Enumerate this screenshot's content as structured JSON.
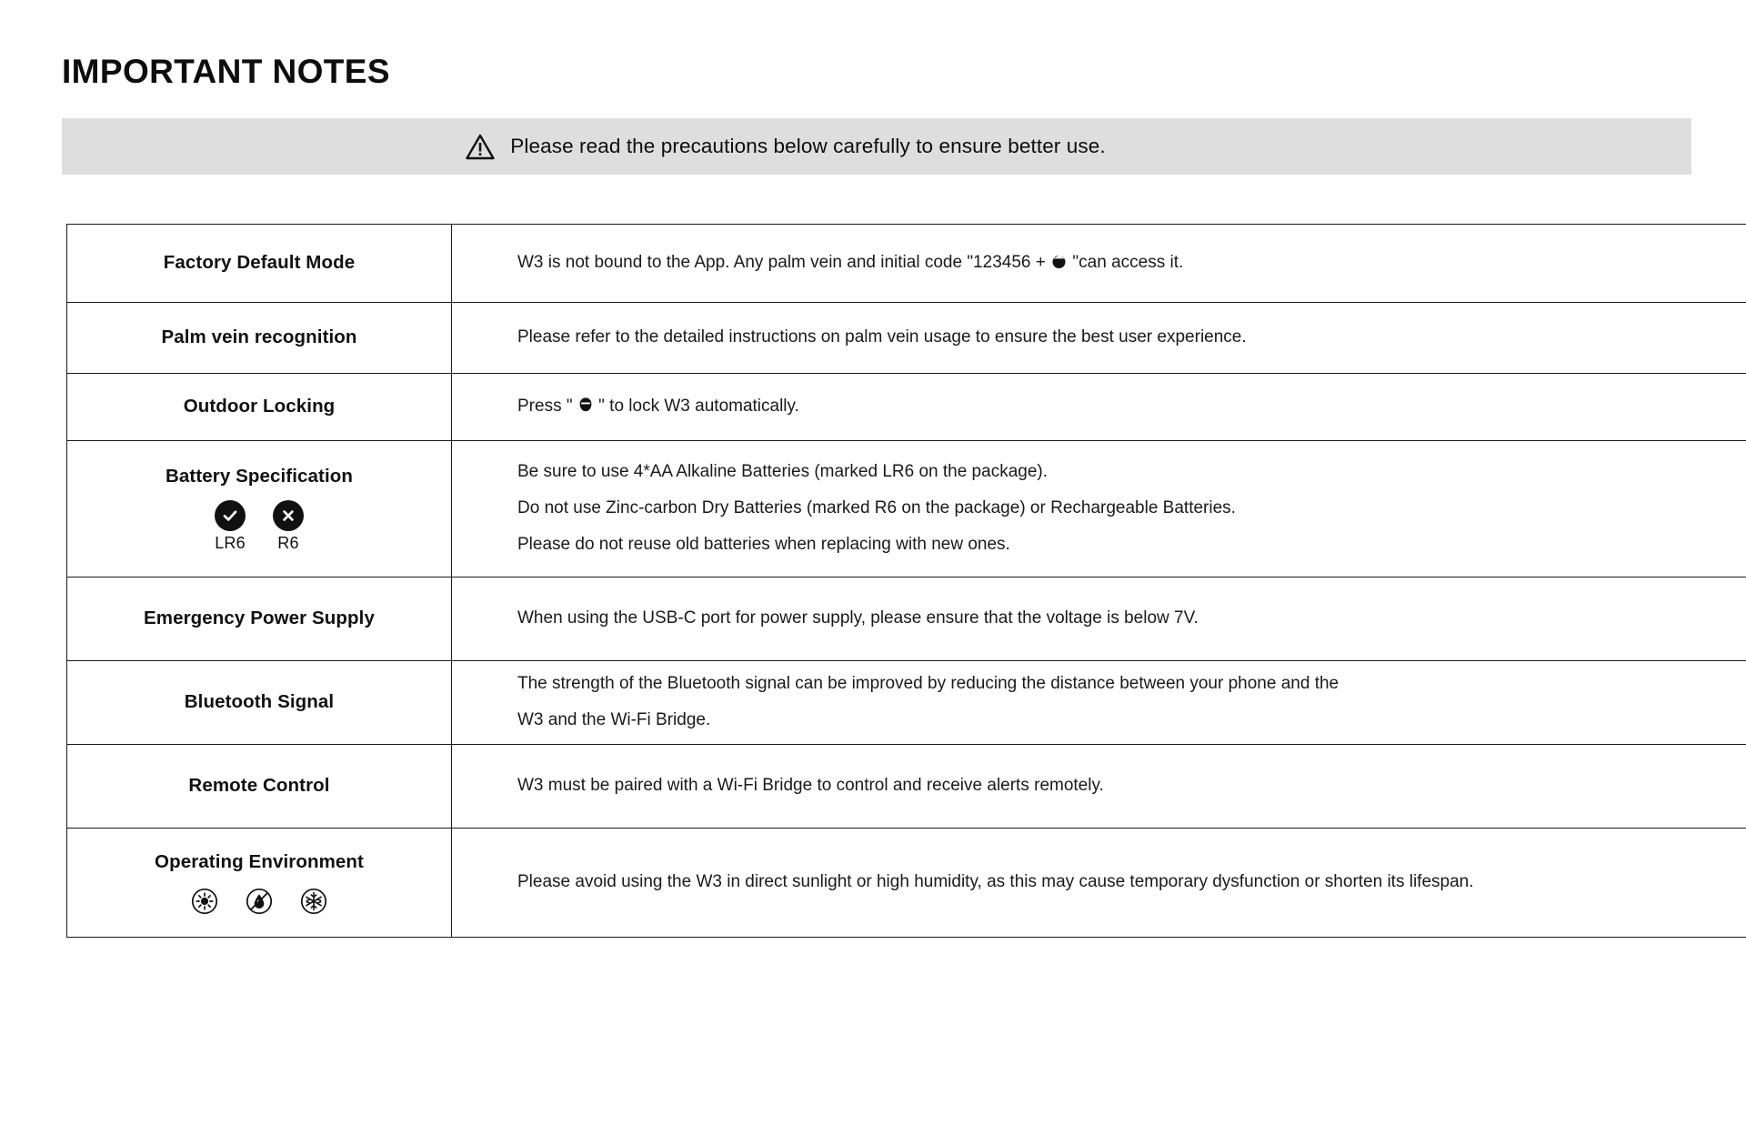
{
  "document": {
    "title": "IMPORTANT NOTES"
  },
  "notice": {
    "icon": "warning-triangle-icon",
    "text": "Please read the precautions below carefully to ensure better use."
  },
  "table": {
    "rows": [
      {
        "label": "Factory Default Mode",
        "lines": [
          {
            "before": "W3 is not bound to the App. Any palm vein and initial code \"123456 +",
            "glyph": "lock-key-icon",
            "after": "\"can access it."
          }
        ]
      },
      {
        "label": "Palm vein recognition",
        "lines": [
          {
            "before": "Please refer to the detailed instructions on palm vein usage to ensure the best user experience.",
            "glyph": "",
            "after": ""
          }
        ]
      },
      {
        "label": "Outdoor Locking",
        "lines": [
          {
            "before": "Press \"",
            "glyph": "lock-button-icon",
            "after": "\" to lock W3 automatically."
          }
        ]
      },
      {
        "label": "Battery Specification",
        "marks": [
          {
            "badge": "check-icon",
            "caption": "LR6"
          },
          {
            "badge": "cross-icon",
            "caption": "R6"
          }
        ],
        "lines": [
          {
            "before": "Be sure to use 4*AA Alkaline Batteries (marked LR6 on the package).",
            "glyph": "",
            "after": ""
          },
          {
            "before": "Do not use Zinc-carbon Dry Batteries (marked R6 on the package) or Rechargeable Batteries.",
            "glyph": "",
            "after": ""
          },
          {
            "before": "Please do not reuse old batteries when replacing with new ones.",
            "glyph": "",
            "after": ""
          }
        ]
      },
      {
        "label": "Emergency Power Supply",
        "lines": [
          {
            "before": "When using the USB-C port for power supply, please ensure that the voltage is below 7V.",
            "glyph": "",
            "after": ""
          }
        ]
      },
      {
        "label": "Bluetooth Signal",
        "lines": [
          {
            "before": "The strength of the Bluetooth signal can be improved by reducing the distance between your phone and the",
            "glyph": "",
            "after": ""
          },
          {
            "before": "W3 and the Wi-Fi Bridge.",
            "glyph": "",
            "after": ""
          }
        ]
      },
      {
        "label": "Remote Control",
        "lines": [
          {
            "before": "W3 must be paired with a Wi-Fi Bridge to control and receive alerts remotely.",
            "glyph": "",
            "after": ""
          }
        ]
      },
      {
        "label": "Operating Environment",
        "env_icons": [
          "no-direct-sunlight-icon",
          "no-water-drop-icon",
          "no-freezing-snowflake-icon"
        ],
        "lines": [
          {
            "before": "Please avoid using the W3 in direct sunlight or high humidity, as this may cause temporary dysfunction or shorten its lifespan.",
            "glyph": "",
            "after": ""
          }
        ]
      }
    ]
  },
  "colors": {
    "page_background": "#ffffff",
    "banner_background": "#dedede",
    "text": "#111111",
    "table_border": "#1a1a1a",
    "badge_fill": "#111111"
  }
}
